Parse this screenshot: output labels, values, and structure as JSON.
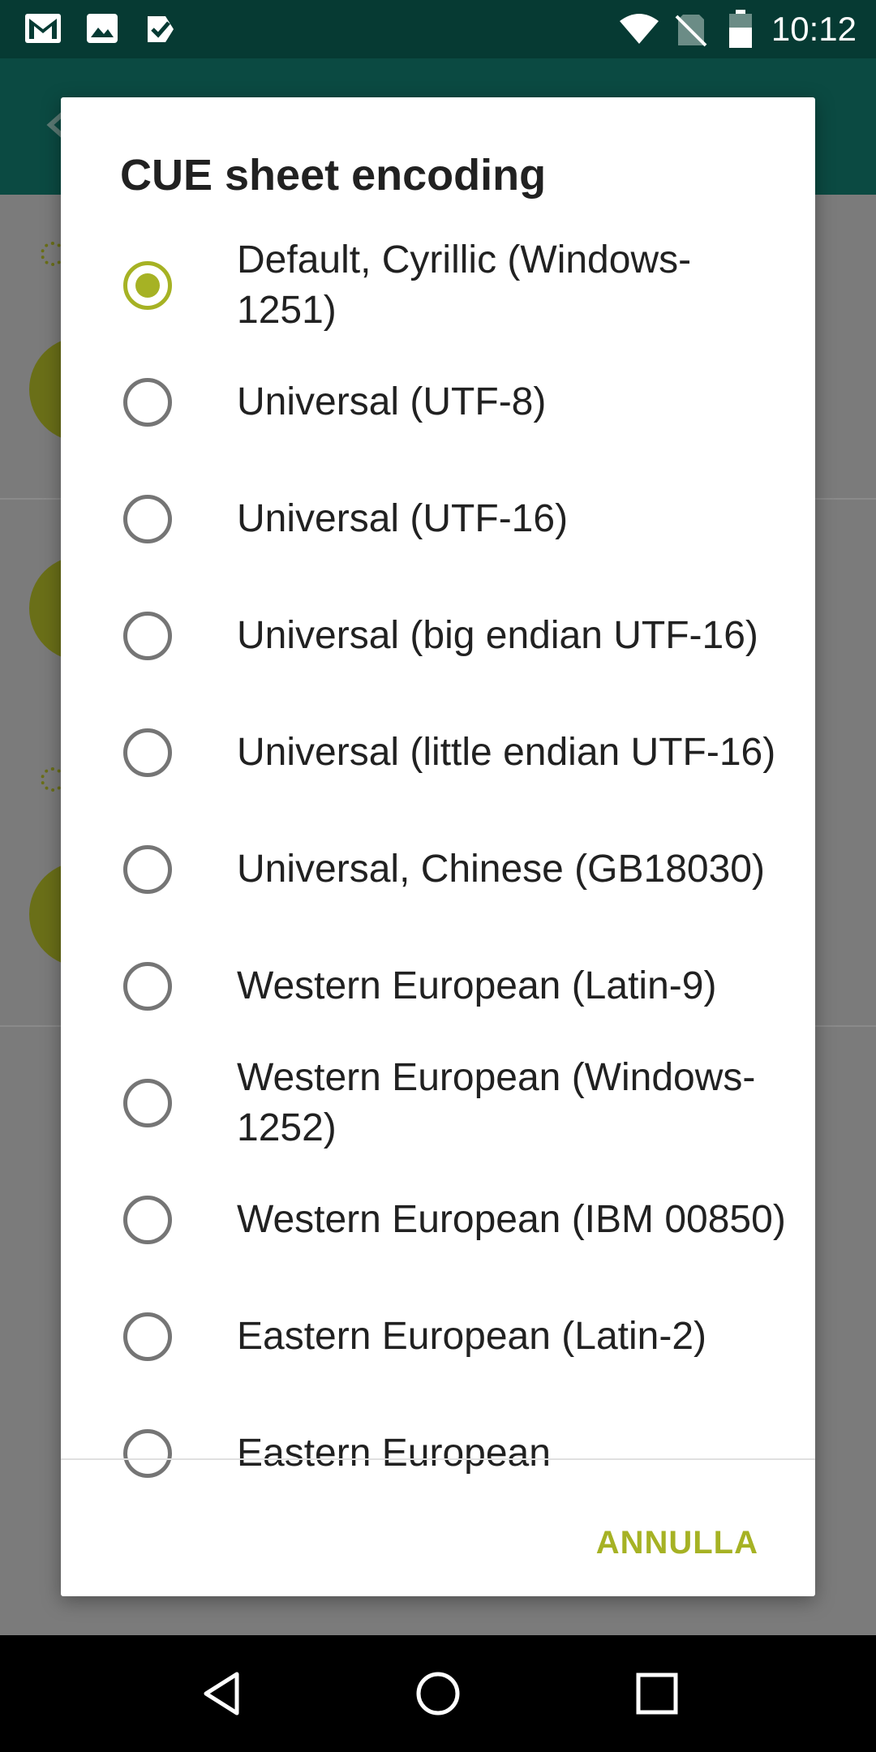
{
  "status_bar": {
    "time": "10:12",
    "left_icons": [
      "gmail-icon",
      "image-icon",
      "tasks-check-icon"
    ],
    "right_icons": [
      "wifi-icon",
      "no-sim-icon",
      "battery-icon"
    ]
  },
  "background_app": {
    "toolbar_color": "#0b4a42",
    "accent_color": "#a6b224"
  },
  "dialog": {
    "title": "CUE sheet encoding",
    "options": [
      {
        "label": "Default, Cyrillic (Windows-1251)",
        "checked": true
      },
      {
        "label": "Universal (UTF-8)",
        "checked": false
      },
      {
        "label": "Universal (UTF-16)",
        "checked": false
      },
      {
        "label": "Universal (big endian UTF-16)",
        "checked": false
      },
      {
        "label": "Universal (little endian UTF-16)",
        "checked": false
      },
      {
        "label": "Universal, Chinese (GB18030)",
        "checked": false
      },
      {
        "label": "Western European (Latin-9)",
        "checked": false
      },
      {
        "label": "Western European (Windows-1252)",
        "checked": false
      },
      {
        "label": "Western European (IBM 00850)",
        "checked": false
      },
      {
        "label": "Eastern European (Latin-2)",
        "checked": false
      },
      {
        "label": "Eastern European",
        "checked": false
      }
    ],
    "cancel_label": "ANNULLA"
  },
  "nav_bar": {
    "buttons": [
      "back-icon",
      "home-icon",
      "recents-icon"
    ]
  }
}
